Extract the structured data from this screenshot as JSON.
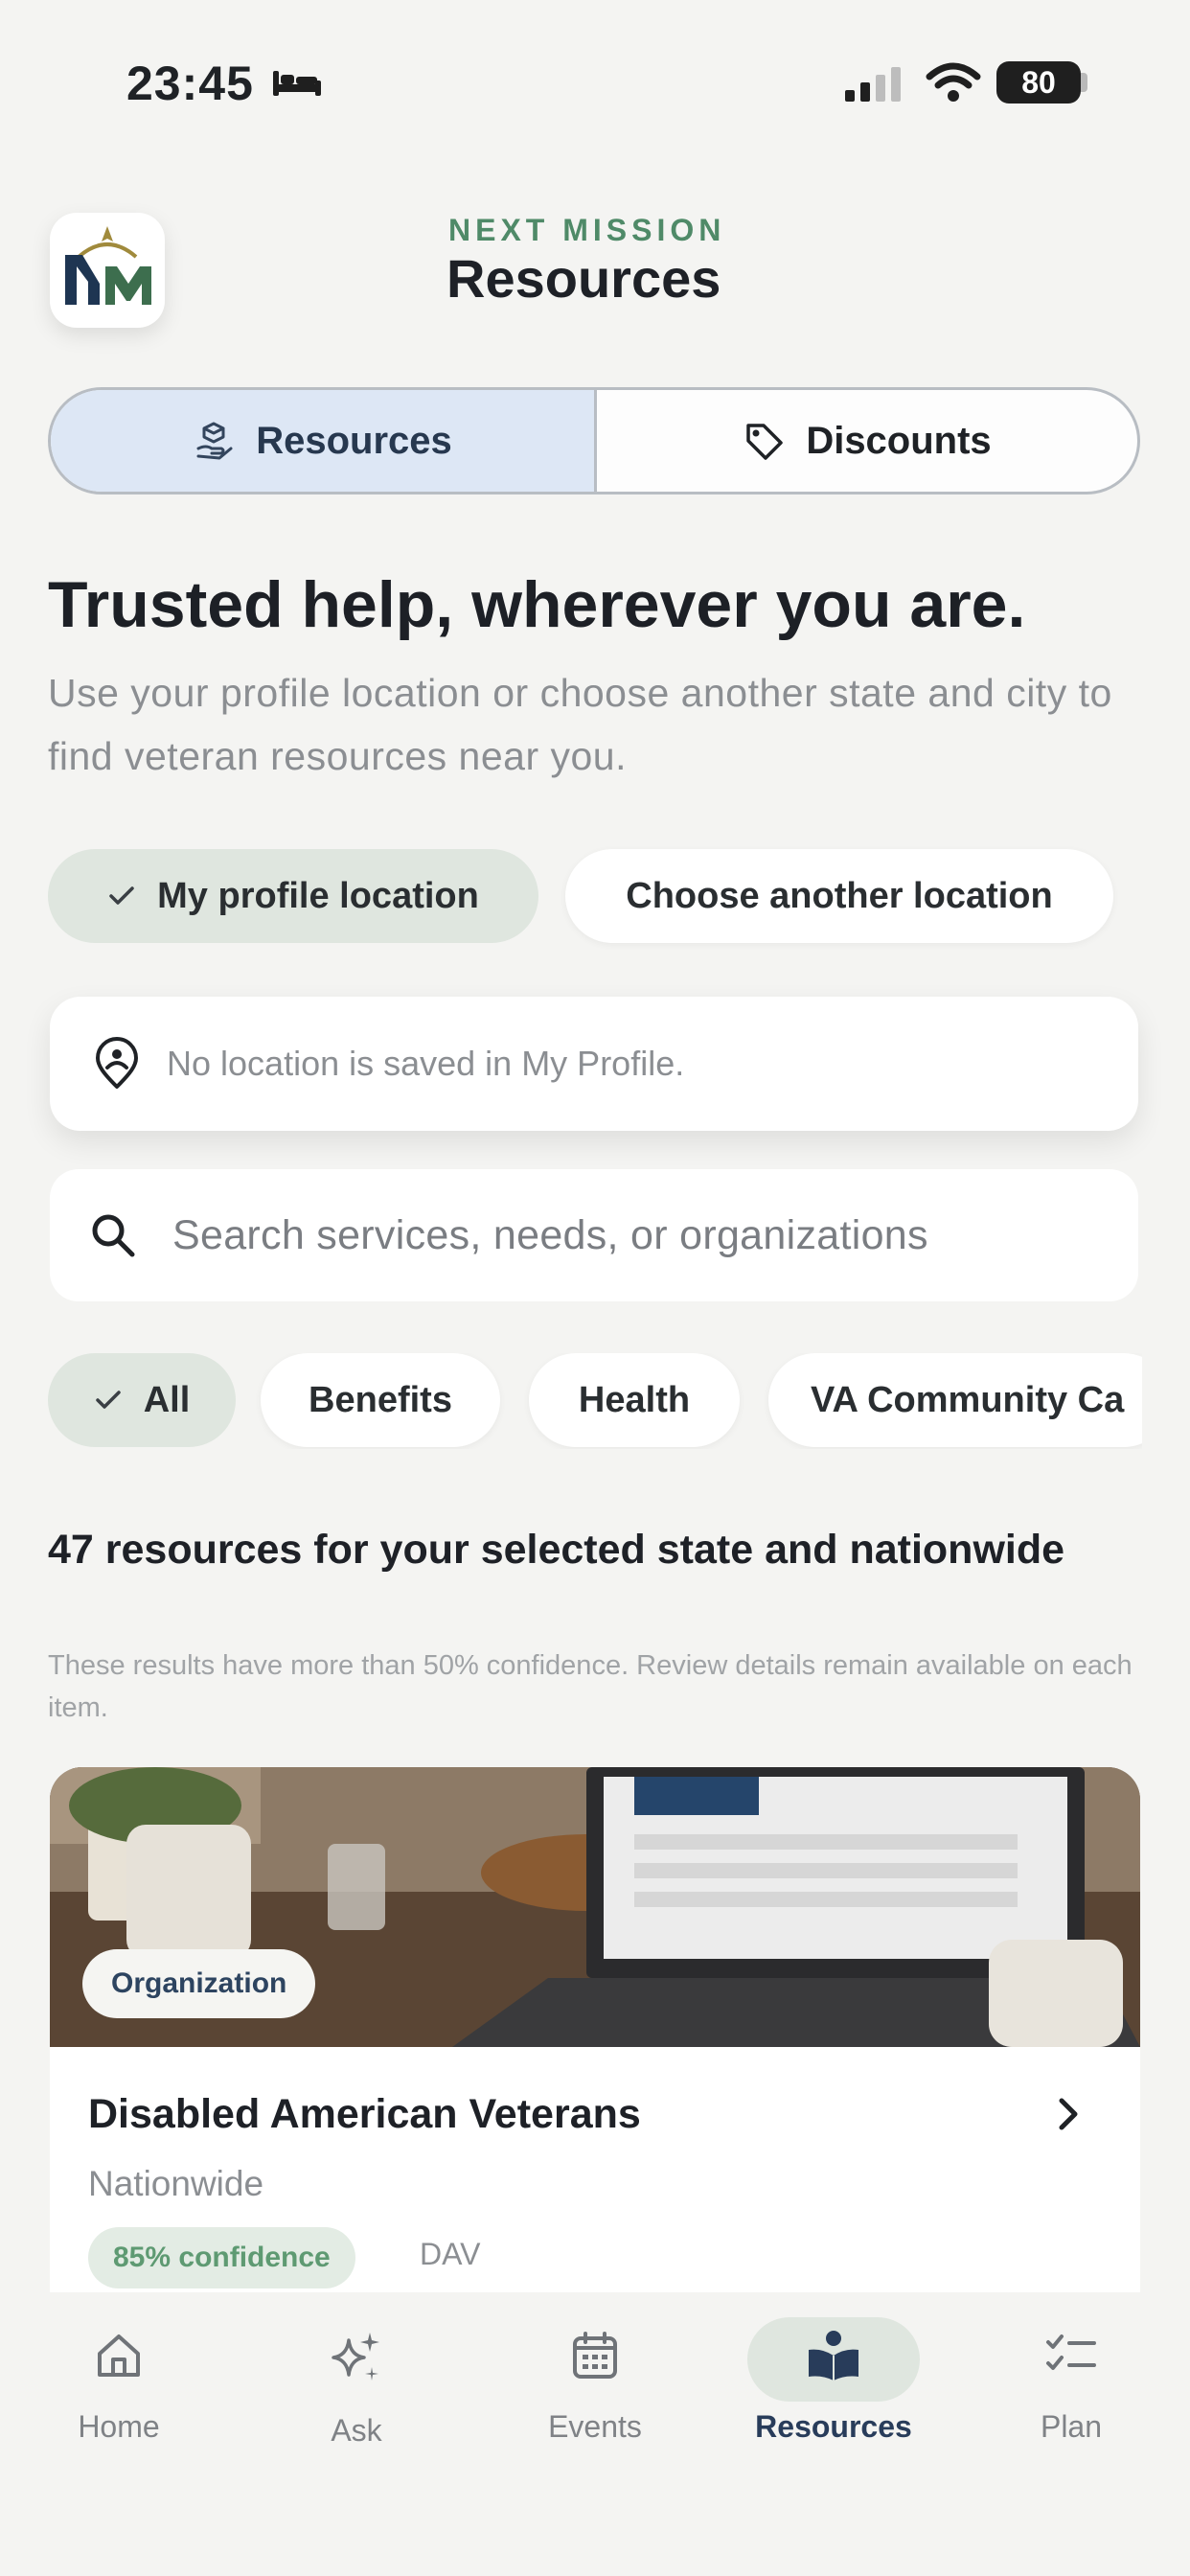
{
  "status_bar": {
    "time": "23:45",
    "battery": "80"
  },
  "header": {
    "brand": "NEXT MISSION",
    "title": "Resources"
  },
  "segments": {
    "resources": "Resources",
    "discounts": "Discounts"
  },
  "hero": {
    "headline": "Trusted help, wherever you are.",
    "subtitle": "Use your profile location or choose another state and city to find veteran resources near you."
  },
  "location": {
    "my_profile_label": "My profile location",
    "choose_another_label": "Choose another location",
    "status_text": "No location is saved in My Profile."
  },
  "search": {
    "placeholder": "Search services, needs, or organizations"
  },
  "filters": [
    "All",
    "Benefits",
    "Health",
    "VA Community Ca"
  ],
  "results": {
    "count_text": "47 resources for your selected state and nationwide",
    "note": "These results have more than 50% confidence. Review details remain available on each item."
  },
  "card": {
    "badge": "Organization",
    "title": "Disabled American Veterans",
    "location": "Nationwide",
    "confidence": "85% confidence",
    "abbreviation": "DAV"
  },
  "nav": [
    {
      "label": "Home",
      "icon": "home-icon"
    },
    {
      "label": "Ask",
      "icon": "sparkles-icon"
    },
    {
      "label": "Events",
      "icon": "calendar-icon"
    },
    {
      "label": "Resources",
      "icon": "book-reader-icon",
      "active": true
    },
    {
      "label": "Plan",
      "icon": "checklist-icon"
    }
  ],
  "colors": {
    "accent_green": "#4f8a68",
    "active_blue_bg": "#dde7f5",
    "chip_green": "#dfe6df",
    "nav_active": "#283c5a"
  }
}
